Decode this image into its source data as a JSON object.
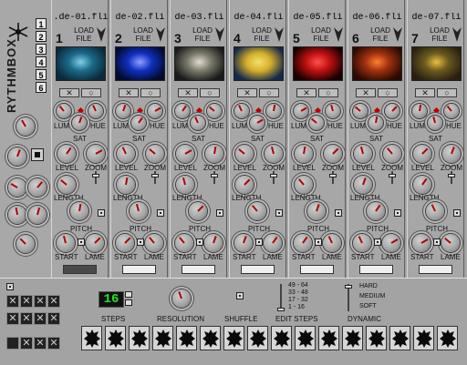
{
  "app": {
    "name": "RYTHMBOX"
  },
  "banks": [
    "1",
    "2",
    "3",
    "4",
    "5",
    "6"
  ],
  "channels": [
    {
      "number": "1",
      "file": ".de-01.fli",
      "thumb_colors": [
        "#0a2a3a",
        "#1b6a8a",
        "#7fd0e8"
      ]
    },
    {
      "number": "2",
      "file": "de-02.fli",
      "thumb_colors": [
        "#020a30",
        "#1030c0",
        "#90a0ff"
      ]
    },
    {
      "number": "3",
      "file": "de-03.fli",
      "thumb_colors": [
        "#1a1a1a",
        "#7a7a6a",
        "#e0dcd0"
      ]
    },
    {
      "number": "4",
      "file": "de-04.fli",
      "thumb_colors": [
        "#14284a",
        "#d8b02a",
        "#f0e070"
      ]
    },
    {
      "number": "5",
      "file": "de-05.fli",
      "thumb_colors": [
        "#180000",
        "#c01010",
        "#ff5050"
      ]
    },
    {
      "number": "6",
      "file": "de-06.fli",
      "thumb_colors": [
        "#2a0a00",
        "#a03010",
        "#ff8030"
      ]
    },
    {
      "number": "7",
      "file": "de-07.fli",
      "thumb_colors": [
        "#2a2010",
        "#6a5a20",
        "#e8c040"
      ]
    }
  ],
  "channel_labels": {
    "load": "LOAD",
    "file": "FILE",
    "toggle_x": "✕",
    "toggle_o": "○",
    "lum": "LUM",
    "hue": "HUE",
    "sat": "SAT",
    "level": "LEVEL",
    "zoom": "ZOOM",
    "length": "LENGTH",
    "pitch": "PITCH",
    "start": "START",
    "lame": "LAME"
  },
  "sequencer": {
    "steps_display": "16",
    "steps_label": "STEPS",
    "resolution_label": "RESOLUTION",
    "shuffle_label": "SHUFFLE",
    "edit_steps_label": "EDIT STEPS",
    "edit_steps_options": [
      "49 - 64",
      "33 - 48",
      "17 - 32",
      "1 - 16"
    ],
    "dynamic_label": "DYNAMIC",
    "dynamic_options": [
      "HARD",
      "MEDIUM",
      "SOFT"
    ],
    "step_count": 16
  },
  "colors": {
    "panel": "#a7a7a7",
    "indicator": "#c00000",
    "led": "#28e028"
  }
}
